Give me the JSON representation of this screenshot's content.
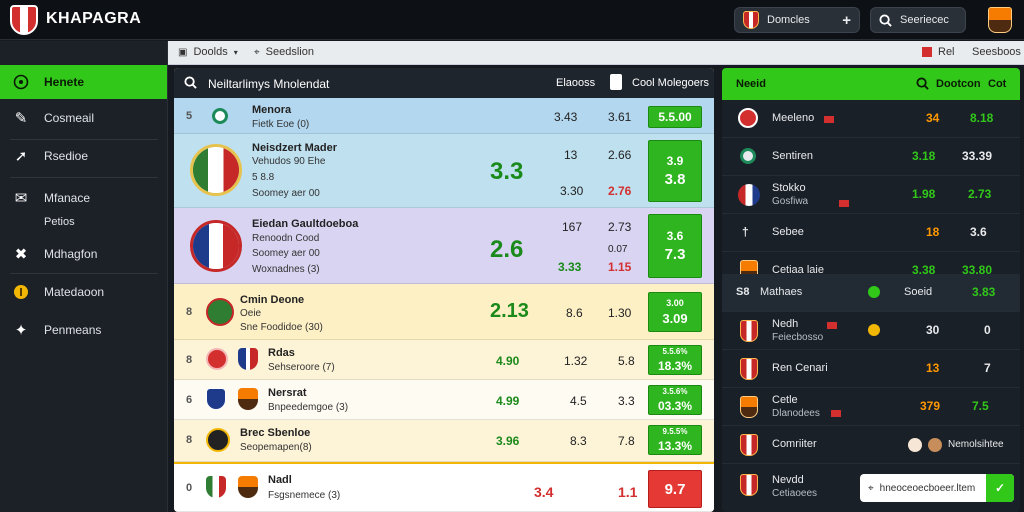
{
  "app": {
    "name": "KHAPAGRA"
  },
  "topbar": {
    "team_pill": {
      "label": "Domcles",
      "add_icon": "plus-icon"
    },
    "search_pill": {
      "label": "Seeriecec",
      "icon": "search-icon"
    }
  },
  "sidebar": {
    "items": [
      {
        "label": "Henete",
        "icon": "pitch-icon",
        "active": true
      },
      {
        "label": "Cosmeail",
        "icon": "whistle-icon"
      },
      {
        "label": "Rsedioe",
        "icon": "arrow-icon"
      },
      {
        "label": "Mfanace",
        "icon": "envelope-icon"
      },
      {
        "label": "Petios",
        "icon": "none"
      },
      {
        "label": "Mdhagfon",
        "icon": "tools-icon"
      },
      {
        "label": "Matedaoon",
        "icon": "coin-icon"
      },
      {
        "label": "Penmeans",
        "icon": "network-icon"
      }
    ]
  },
  "subbar": {
    "left_menu": "Doolds",
    "left_item2": "Seedslion",
    "right_flag": "Rel",
    "right_label": "Seesboos"
  },
  "main": {
    "header": {
      "title": "Neiltarlimys Mnolendat",
      "col1": "Elaooss",
      "col2": "Cool Molegoers"
    },
    "rows": [
      {
        "rank": "5",
        "title": "Menora",
        "sub": "Fietk Eoe (0)",
        "c1": "3.43",
        "c2": "3.61",
        "odd_top": "5.5.00",
        "odd_bottom": "",
        "bg": "#b3d7ef",
        "style": "slim"
      },
      {
        "rank": "",
        "title": "Neisdzert Mader",
        "sub1": "Vehudos 90 Ehe",
        "sub2": "5 8.8",
        "sub3": "Soomey aer 00",
        "big": "3.3",
        "c1": "13",
        "c2": "2.66",
        "c3": "3.30",
        "c4": "2.76",
        "odd_top": "3.9",
        "odd_bottom": "3.8",
        "bg": "#bfe0ef"
      },
      {
        "rank": "",
        "title": "Eiedan Gaultdoeboa",
        "sub1": "Renoodn Cood",
        "sub2": "Soomey aer 00",
        "sub3": "Woxnadnes (3)",
        "big": "2.6",
        "c1": "167",
        "c2": "2.73",
        "c3": "3.33",
        "c4": "0.07",
        "c5": "1.15",
        "odd_top": "3.6",
        "odd_bottom": "7.3",
        "bg": "#d8d4f1"
      },
      {
        "rank": "8",
        "title": "Cmin Deone",
        "sub1": "Oeie",
        "sub2": "Sne Foodidoe (30)",
        "big": "2.13",
        "c1": "8.6",
        "c2": "1.30",
        "odd_top": "3.00",
        "odd_bottom": "3.09",
        "bg": "#fdf0c5"
      },
      {
        "rank": "8",
        "title": "Rdas",
        "sub1": "Sehseroore (7)",
        "c0": "4.90",
        "c1": "1.32",
        "c2": "5.8",
        "odd_top": "5.5.6%",
        "odd_bottom": "18.3%",
        "bg": "#fdf3d7"
      },
      {
        "rank": "6",
        "title": "Nersrat",
        "sub1": "Bnpeedemgoe (3)",
        "c0": "4.99",
        "c1": "4.5",
        "c2": "3.3",
        "odd_top": "3.5.6%",
        "odd_bottom": "03.3%",
        "bg": "#fefbf3"
      },
      {
        "rank": "8",
        "title": "Brec Sbenloe",
        "sub1": "Seopemapen(8)",
        "c0": "3.96",
        "c1": "8.3",
        "c2": "7.8",
        "odd_top": "9.5.5%",
        "odd_bottom": "13.3%",
        "bg": "#fdf3d7"
      },
      {
        "rank": "0",
        "title": "Nadl",
        "sub1": "Fsgsnemece (3)",
        "c0": "3.4",
        "c1": "1.1",
        "odd_top": "",
        "odd_bottom": "9.7",
        "bg": "#ffffff",
        "odd_red": true
      }
    ]
  },
  "right": {
    "header": {
      "title": "Neeid",
      "search_label": "Dootcon",
      "extra": "Cot"
    },
    "rows": [
      {
        "name": "Meeleno",
        "v1": "34",
        "v2": "8.18",
        "c1": "#ff9800",
        "c2": "#31c81a",
        "tag": true
      },
      {
        "name": "Sentiren",
        "v1": "3.18",
        "v2": "33.39",
        "c1": "#31c81a",
        "c2": "#e8eaed"
      },
      {
        "name": "Stokko",
        "sub": "Gosfiwa",
        "v1": "1.98",
        "v2": "2.73",
        "c1": "#31c81a",
        "c2": "#31c81a",
        "tag": true
      },
      {
        "name": "Sebee",
        "v1": "18",
        "v2": "3.6",
        "c1": "#ff9800",
        "c2": "#e8eaed"
      },
      {
        "name": "Cetiaa laie",
        "v1": "3.38",
        "v2": "33.80",
        "c1": "#31c81a",
        "c2": "#31c81a"
      },
      {
        "name": "Mathaes",
        "prefix": "S8",
        "mid": "Soeid",
        "v2": "3.83",
        "c2": "#31c81a"
      },
      {
        "name": "Nedh",
        "sub": "Feiecbosso",
        "v1": "30",
        "v2": "0",
        "c1": "#e8eaed",
        "c2": "#e8eaed",
        "tag": true
      },
      {
        "name": "Ren Cenari",
        "v1": "13",
        "v2": "7",
        "c1": "#ff9800",
        "c2": "#e8eaed"
      },
      {
        "name": "Cetle",
        "sub": "Dlanodees",
        "v1": "379",
        "v2": "7.5",
        "c1": "#ff9800",
        "c2": "#31c81a",
        "tag": true
      },
      {
        "name": "Comriiter",
        "mid": "Nemolsihtee",
        "v2": ""
      },
      {
        "name": "Nevdd",
        "sub": "Cetiaoees"
      }
    ],
    "search_popup": {
      "text": "hneoceoecboeer.ltem"
    }
  }
}
